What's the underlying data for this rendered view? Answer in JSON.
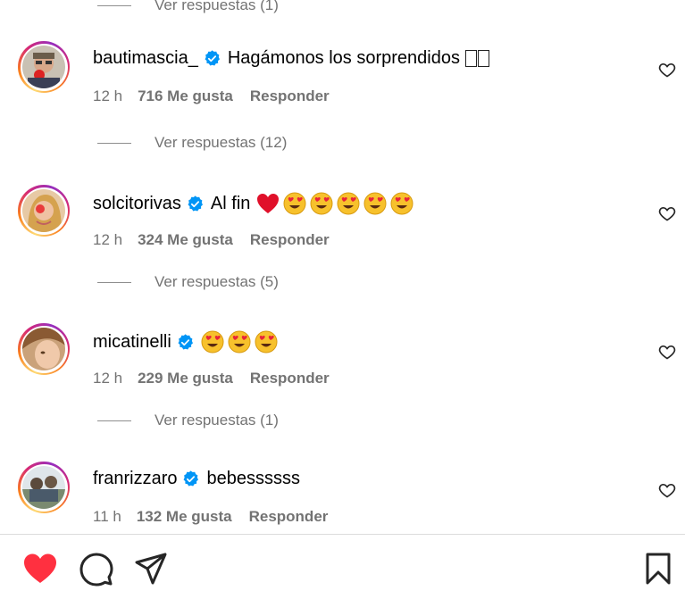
{
  "top_replies": {
    "label": "Ver respuestas (1)"
  },
  "comments": [
    {
      "username": "bautimascia_",
      "verified": true,
      "text": "Hagámonos los sorprendidos",
      "trailing_glyphs": 2,
      "time": "12 h",
      "likes": "716 Me gusta",
      "reply": "Responder",
      "view_replies": "Ver respuestas (12)",
      "avatar_icon": "avatar-photo"
    },
    {
      "username": "solcitorivas",
      "verified": true,
      "text": "Al fin",
      "emojis": [
        "red-heart",
        "heart-eyes",
        "heart-eyes",
        "heart-eyes",
        "heart-eyes",
        "heart-eyes"
      ],
      "time": "12 h",
      "likes": "324 Me gusta",
      "reply": "Responder",
      "view_replies": "Ver respuestas (5)",
      "avatar_icon": "avatar-photo"
    },
    {
      "username": "micatinelli",
      "verified": true,
      "text": "",
      "emojis": [
        "heart-eyes",
        "heart-eyes",
        "heart-eyes"
      ],
      "time": "12 h",
      "likes": "229 Me gusta",
      "reply": "Responder",
      "view_replies": "Ver respuestas (1)",
      "avatar_icon": "avatar-photo"
    },
    {
      "username": "franrizzaro",
      "verified": true,
      "text": "bebessssss",
      "time": "11 h",
      "likes": "132 Me gusta",
      "reply": "Responder",
      "avatar_icon": "avatar-photo"
    }
  ],
  "bottom_bar": {
    "icons": [
      "heart-filled-icon",
      "comment-icon",
      "share-icon",
      "bookmark-icon"
    ],
    "like_color": "#ff3040"
  },
  "colors": {
    "verified_blue": "#0095f6",
    "secondary_text": "#737373",
    "ring_gradient": [
      "#feda75",
      "#fa7e1e",
      "#d62976",
      "#962fbf"
    ]
  }
}
